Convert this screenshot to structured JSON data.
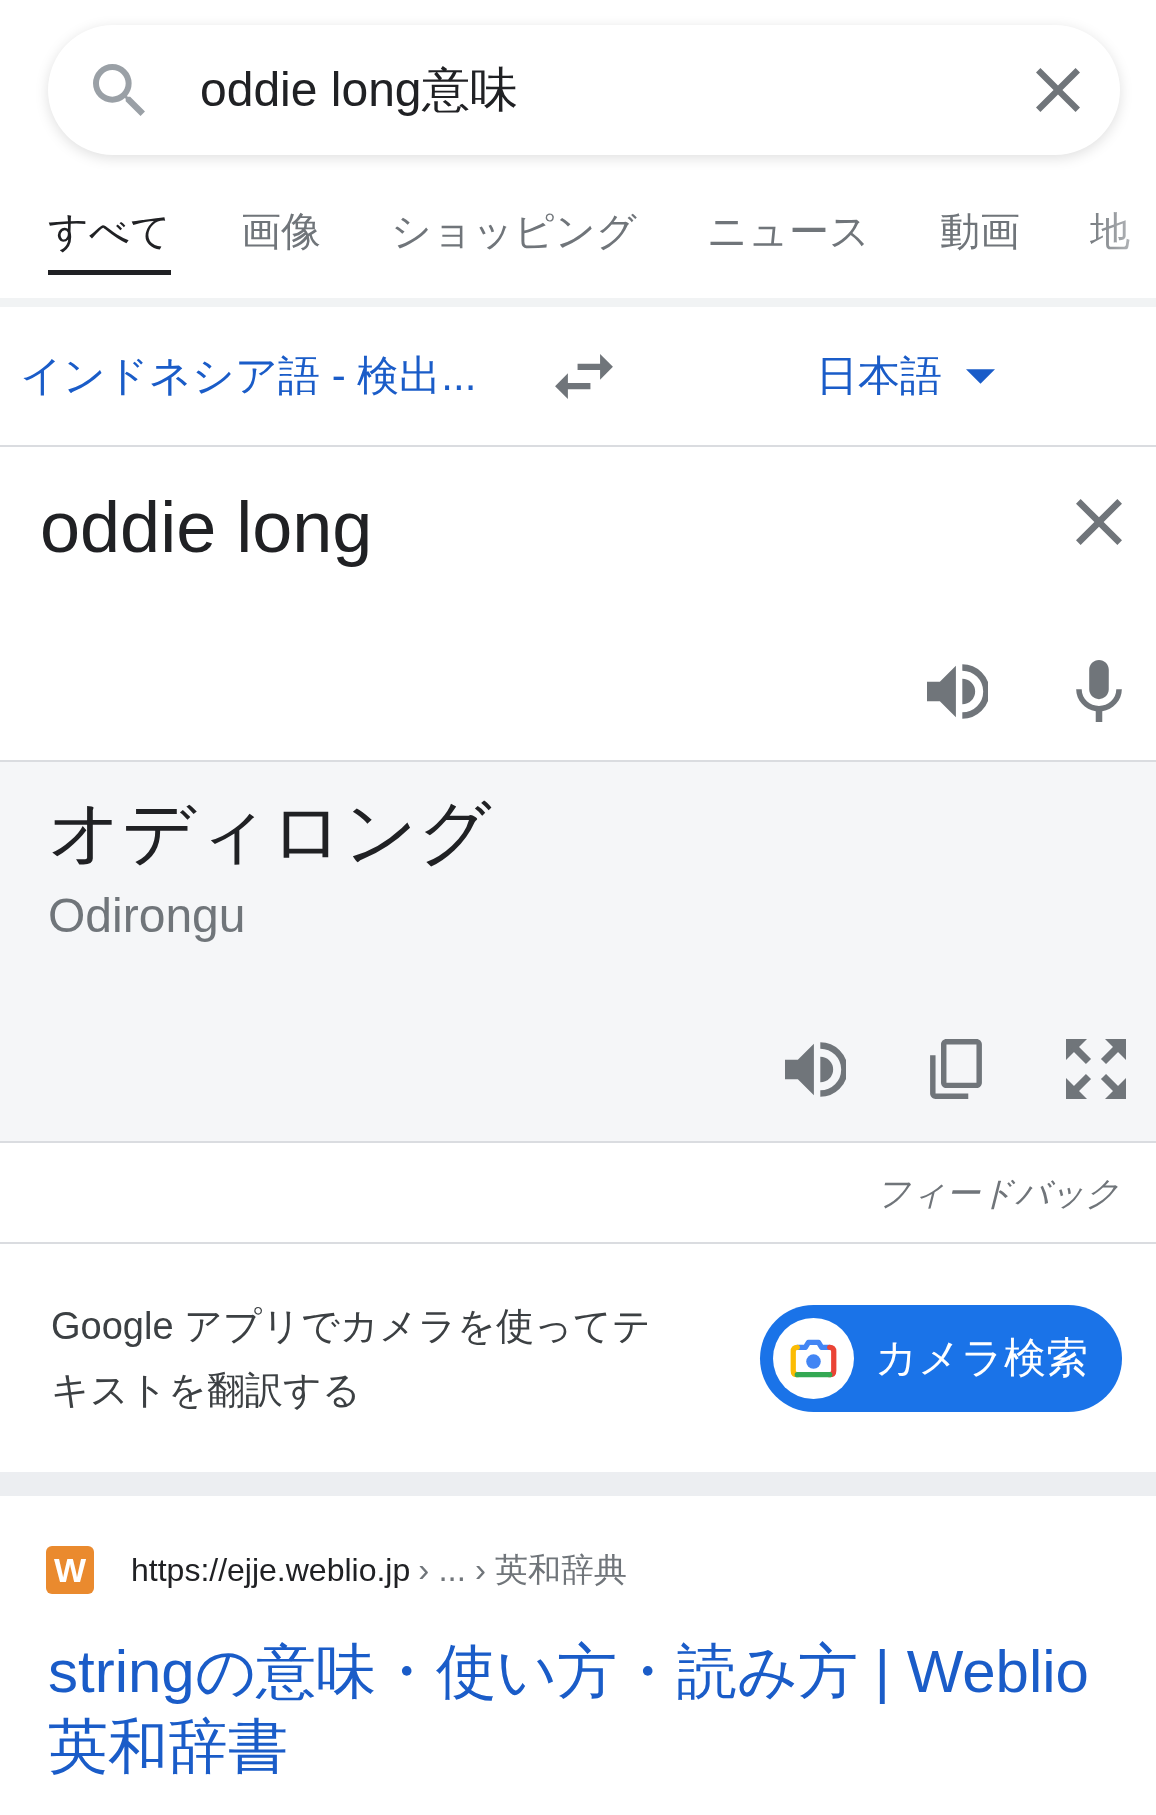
{
  "search_bar": {
    "query": "oddie long意味"
  },
  "tabs": [
    {
      "label": "すべて",
      "selected": true
    },
    {
      "label": "画像",
      "selected": false
    },
    {
      "label": "ショッピング",
      "selected": false
    },
    {
      "label": "ニュース",
      "selected": false
    },
    {
      "label": "動画",
      "selected": false
    },
    {
      "label": "地",
      "selected": false
    }
  ],
  "translator": {
    "source_language": "インドネシア語 - 検出...",
    "target_language": "日本語",
    "input_text": "oddie long",
    "translation": "オディロング",
    "romanization": "Odirongu",
    "feedback": "フィードバック"
  },
  "camera_promo": {
    "text": "Google アプリでカメラを使ってテキストを翻訳する",
    "button": "カメラ検索"
  },
  "results": [
    {
      "site_logo": "W",
      "url": "https://ejje.weblio.jp",
      "path": "› ... › 英和辞典",
      "title": "stringの意味・使い方・読み方 | Weblio英和辞書"
    }
  ]
}
